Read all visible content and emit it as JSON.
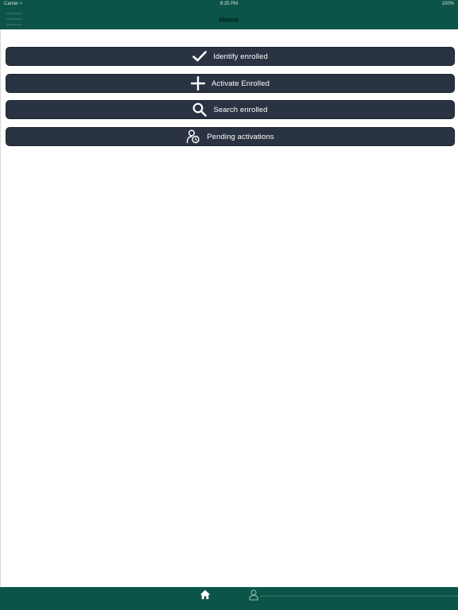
{
  "status_bar": {
    "carrier": "Carrier ≈",
    "time": "8:25 PM",
    "battery": "100%"
  },
  "nav": {
    "title": "Home",
    "menu_icon": "hamburger-menu-icon"
  },
  "actions": [
    {
      "label": "Identify enrolled",
      "icon": "checkmark-icon"
    },
    {
      "label": "Activate Enrolled",
      "icon": "plus-icon"
    },
    {
      "label": "Search enrolled",
      "icon": "search-icon"
    },
    {
      "label": "Pending activations",
      "icon": "user-clock-icon"
    }
  ],
  "tab_bar": {
    "items": [
      {
        "icon": "home-icon",
        "selected": true
      },
      {
        "icon": "user-icon",
        "selected": false
      }
    ]
  },
  "colors": {
    "header": "#0c5447",
    "button": "#2a3342",
    "button_text": "#ffffff",
    "background": "#ffffff"
  }
}
